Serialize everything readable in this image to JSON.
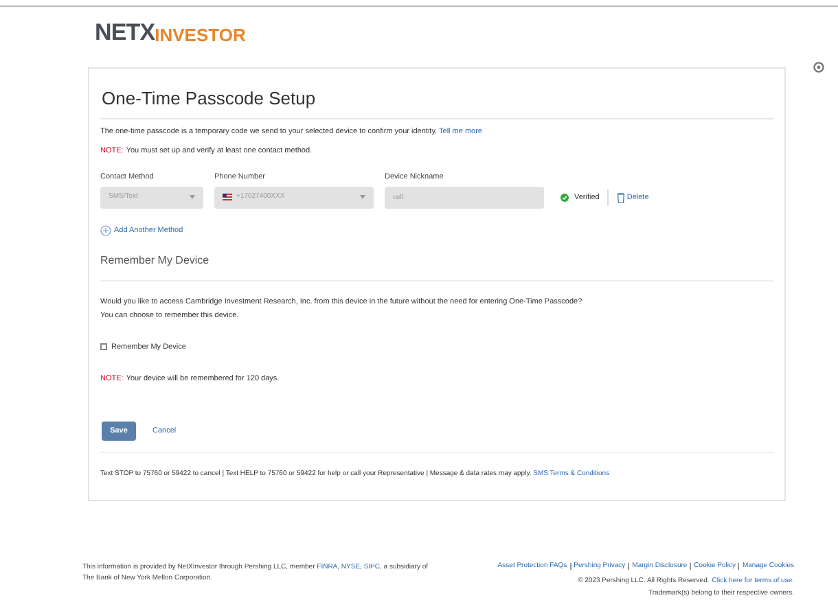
{
  "logo": {
    "part_1": "NETX",
    "part_2": "INVESTOR"
  },
  "title": "One-Time Passcode Setup",
  "intro": {
    "text": "The one-time passcode is a temporary code we send to your selected device to confirm your identity.",
    "link": "Tell me more"
  },
  "note_1": {
    "label": "NOTE:",
    "text": "You must set up and verify at least one contact method."
  },
  "method": {
    "contact_label": "Contact Method",
    "contact_value": "SMS/Text",
    "phone_label": "Phone Number",
    "phone_value": "+17027400XXX",
    "nickname_label": "Device Nickname",
    "nickname_value": "cell",
    "verified": true,
    "status": "Verified",
    "delete": "Delete"
  },
  "add_method": "Add Another Method",
  "remember": {
    "heading": "Remember My Device",
    "question": "Would you like to access Cambridge Investment Research, Inc. from this device in the future without the need for entering One-Time Passcode?",
    "hint": "You can choose to remember this device.",
    "checkbox_label": "Remember My Device",
    "checked": false,
    "note_label": "NOTE:",
    "note_text": "Your device will be remembered for 120 days."
  },
  "buttons": {
    "save": "Save",
    "cancel": "Cancel"
  },
  "sms": {
    "text": "Text STOP to 75760 or 59422 to cancel | Text HELP to 75760 or 59422 for help or call your Representative | Message & data rates may apply.",
    "link": "SMS Terms & Conditions"
  },
  "footer": {
    "disclosure": "This information is provided by NetXInvestor through Pershing LLC, member",
    "links_inline": [
      "FINRA",
      "NYSE",
      "SIPC"
    ],
    "separator": ",",
    "disclosure_end": "a subsidiary of The Bank of New York Mellon Corporation.",
    "links": [
      "Asset Protection FAQs",
      "Pershing Privacy",
      "Margin Disclosure",
      "Cookie Policy",
      "Manage Cookies"
    ],
    "copyright": "© 2023 Pershing LLC. All Rights Reserved.",
    "terms": "Click here for terms of use.",
    "trademark": "Trademark(s) belong to their respective owners."
  }
}
